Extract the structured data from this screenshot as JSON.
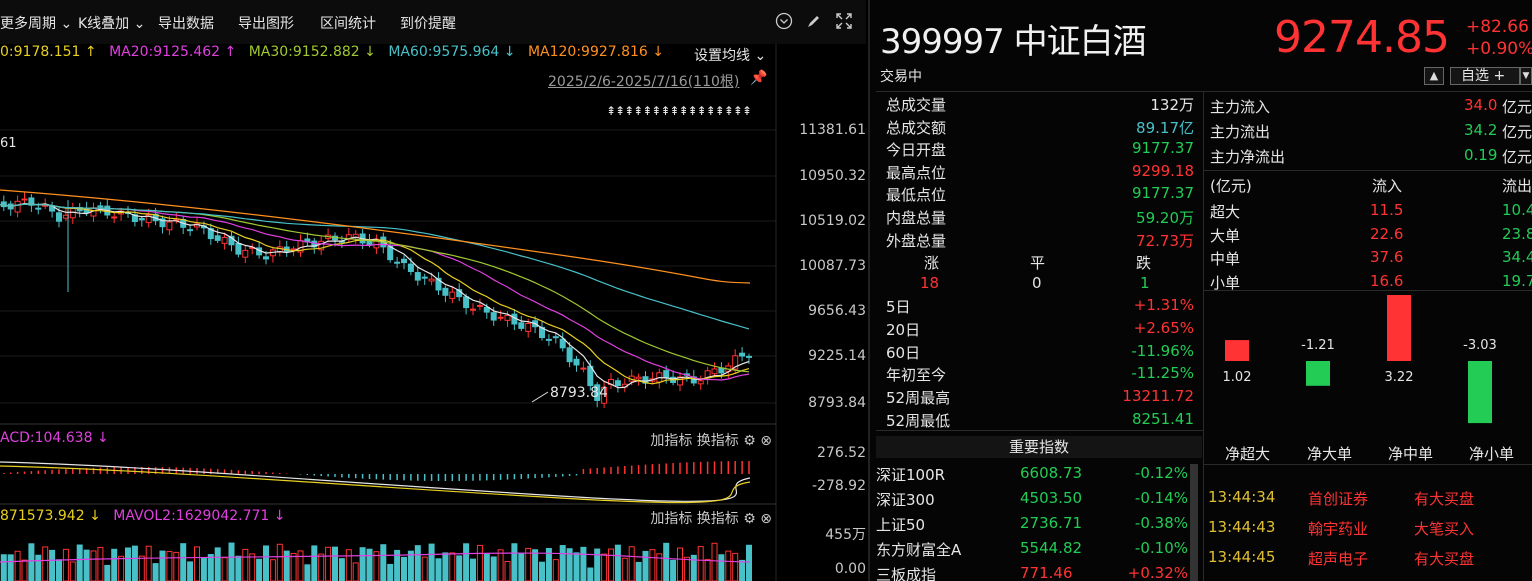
{
  "toolbar": {
    "more_period": "更多周期",
    "kline_overlay": "K线叠加",
    "export_data": "导出数据",
    "export_image": "导出图形",
    "range_stats": "区间统计",
    "price_alert": "到价提醒"
  },
  "ma": {
    "ma10": "0:9178.151 ↑",
    "ma20": "MA20:9125.462 ↑",
    "ma30": "MA30:9152.882 ↓",
    "ma60": "MA60:9575.964 ↓",
    "ma120": "MA120:9927.816 ↓",
    "setting": "设置均线",
    "left_partial": "61"
  },
  "range": {
    "text": "2025/2/6-2025/7/16(110根)",
    "marks": "⇞⇞⇞⇞⇞⇞⇞⇞⇞⇞⇞⇞⇞⇞⇞⇞"
  },
  "price_axis": [
    "11381.61",
    "10950.32",
    "10519.02",
    "10087.73",
    "9656.43",
    "9225.14",
    "8793.84"
  ],
  "low_label": "8793.84",
  "macd": {
    "label": "ACD:104.638 ↓",
    "axis_top": "276.52",
    "axis_bottom": "-278.92",
    "add_indicator": "加指标",
    "switch_indicator": "换指标"
  },
  "vol": {
    "label1": "871573.942 ↓",
    "label2": "MAVOL2:1629042.771 ↓",
    "axis_top": "455万",
    "axis_bottom": "0.00",
    "add_indicator": "加指标",
    "switch_indicator": "换指标"
  },
  "stock": {
    "code_name": "399997 中证白酒",
    "price": "9274.85",
    "change": "+82.66",
    "change_pct": "+0.90%",
    "status": "交易中",
    "watch_label": "自选 +"
  },
  "stats": [
    {
      "label": "总成交量",
      "value": "132万",
      "color": "#e6e6e6"
    },
    {
      "label": "总成交额",
      "value": "89.17亿",
      "color": "#48c0c8"
    },
    {
      "label": "今日开盘",
      "value": "9177.37",
      "color": "#22cc55"
    },
    {
      "label": "最高点位",
      "value": "9299.18",
      "color": "#ff3333"
    },
    {
      "label": "最低点位",
      "value": "9177.37",
      "color": "#22cc55"
    },
    {
      "label": "内盘总量",
      "value": "59.20万",
      "color": "#22cc55"
    },
    {
      "label": "外盘总量",
      "value": "72.73万",
      "color": "#ff3333"
    }
  ],
  "breadth": {
    "up_label": "涨",
    "flat_label": "平",
    "down_label": "跌",
    "up": "18",
    "flat": "0",
    "down": "1"
  },
  "perf": [
    {
      "label": "5日",
      "value": "+1.31%",
      "color": "#ff3333"
    },
    {
      "label": "20日",
      "value": "+2.65%",
      "color": "#ff3333"
    },
    {
      "label": "60日",
      "value": "-11.96%",
      "color": "#22cc55"
    },
    {
      "label": "年初至今",
      "value": "-11.25%",
      "color": "#22cc55"
    },
    {
      "label": "52周最高",
      "value": "13211.72",
      "color": "#ff3333"
    },
    {
      "label": "52周最低",
      "value": "8251.41",
      "color": "#22cc55"
    }
  ],
  "fund_flow": {
    "main_in_label": "主力流入",
    "main_in": "34.0",
    "main_in_unit": "亿元",
    "main_out_label": "主力流出",
    "main_out": "34.2",
    "main_out_unit": "亿元",
    "main_net_label": "主力净流出",
    "main_net": "0.19",
    "main_net_unit": "亿元",
    "unit_header": "(亿元)",
    "in_header": "流入",
    "out_header": "流出",
    "rows": [
      {
        "label": "超大",
        "in": "11.5",
        "out": "10.4"
      },
      {
        "label": "大单",
        "in": "22.6",
        "out": "23.8"
      },
      {
        "label": "中单",
        "in": "37.6",
        "out": "34.4"
      },
      {
        "label": "小单",
        "in": "16.6",
        "out": "19.7"
      }
    ]
  },
  "net_bars": {
    "labels": [
      "净超大",
      "净大单",
      "净中单",
      "净小单"
    ],
    "values": [
      1.02,
      -1.21,
      3.22,
      -3.03
    ],
    "value_labels": [
      "1.02",
      "-1.21",
      "3.22",
      "-3.03"
    ]
  },
  "index_header": "重要指数",
  "indices": [
    {
      "name": "深证100R",
      "price": "6608.73",
      "change": "-0.12%",
      "pcolor": "#22cc55",
      "ccolor": "#22cc55"
    },
    {
      "name": "深证300",
      "price": "4503.50",
      "change": "-0.14%",
      "pcolor": "#22cc55",
      "ccolor": "#22cc55"
    },
    {
      "name": "上证50",
      "price": "2736.71",
      "change": "-0.38%",
      "pcolor": "#22cc55",
      "ccolor": "#22cc55"
    },
    {
      "name": "东方财富全A",
      "price": "5544.82",
      "change": "-0.10%",
      "pcolor": "#22cc55",
      "ccolor": "#22cc55"
    },
    {
      "name": "三板成指",
      "price": "771.46",
      "change": "+0.32%",
      "pcolor": "#ff3333",
      "ccolor": "#ff3333"
    }
  ],
  "ticks": [
    {
      "time": "13:44:34",
      "stock": "首创证券",
      "kind": "有大买盘"
    },
    {
      "time": "13:44:43",
      "stock": "翰宇药业",
      "kind": "大笔买入"
    },
    {
      "time": "13:44:45",
      "stock": "超声电子",
      "kind": "有大买盘"
    }
  ],
  "colors": {
    "up": "#ff3333",
    "down": "#22cc55",
    "ma5": "#e6e6e6",
    "ma10": "#e8d020",
    "ma20": "#e040e0",
    "ma30": "#a0c830",
    "ma60": "#48c0c8",
    "ma120": "#ff9020"
  }
}
